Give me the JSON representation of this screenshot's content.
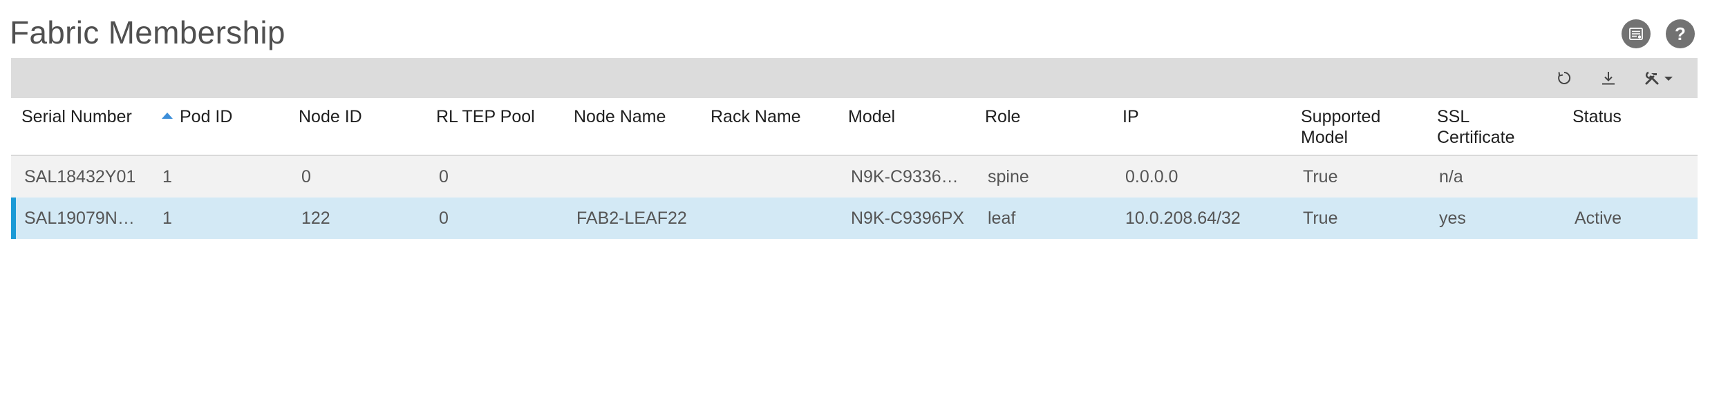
{
  "header": {
    "title": "Fabric Membership",
    "list_icon": "list-settings-icon",
    "help_label": "?"
  },
  "toolbar": {
    "refresh_icon": "refresh-icon",
    "download_icon": "download-icon",
    "tools_icon": "tools-menu-icon"
  },
  "table": {
    "sort_column": "Pod ID",
    "sort_direction": "ascending",
    "columns": [
      {
        "line1": "Serial Number",
        "line2": ""
      },
      {
        "line1": "Pod ID",
        "line2": ""
      },
      {
        "line1": "Node ID",
        "line2": ""
      },
      {
        "line1": "RL TEP Pool",
        "line2": ""
      },
      {
        "line1": "Node Name",
        "line2": ""
      },
      {
        "line1": "Rack Name",
        "line2": ""
      },
      {
        "line1": "Model",
        "line2": ""
      },
      {
        "line1": "Role",
        "line2": ""
      },
      {
        "line1": "IP",
        "line2": ""
      },
      {
        "line1": "Supported",
        "line2": "Model"
      },
      {
        "line1": "SSL",
        "line2": "Certificate"
      },
      {
        "line1": "Status",
        "line2": ""
      }
    ],
    "rows": [
      {
        "serial": "SAL18432Y01",
        "pod_id": "1",
        "node_id": "0",
        "rl_tep_pool": "0",
        "node_name": "",
        "rack_name": "",
        "model": "N9K-C9336…",
        "role": "spine",
        "ip": "0.0.0.0",
        "supported_model": "True",
        "ssl_certificate": "n/a",
        "status": "",
        "selected": false
      },
      {
        "serial": "SAL19079N…",
        "pod_id": "1",
        "node_id": "122",
        "rl_tep_pool": "0",
        "node_name": "FAB2-LEAF22",
        "rack_name": "",
        "model": "N9K-C9396PX",
        "role": "leaf",
        "ip": "10.0.208.64/32",
        "supported_model": "True",
        "ssl_certificate": "yes",
        "status": "Active",
        "selected": true
      }
    ]
  },
  "colors": {
    "accent": "#1a9ad6",
    "selected_row": "#d3e9f5",
    "row_alt": "#f2f2f2",
    "toolbar": "#dcdcdc",
    "sort_caret": "#3c8ed9"
  }
}
